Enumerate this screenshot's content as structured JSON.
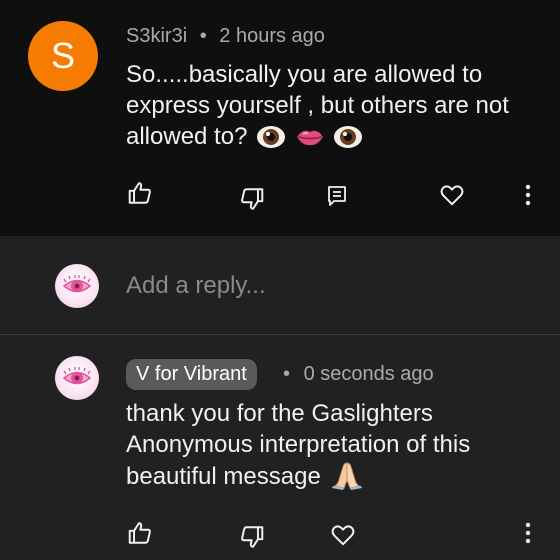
{
  "comment": {
    "avatar_letter": "S",
    "avatar_color": "#f57c00",
    "author": "S3kir3i",
    "separator": "•",
    "time": "2 hours ago",
    "text": "So.....basically you are allowed to express yourself , but others are not allowed to?",
    "emojis": [
      "eye-emoji",
      "lips-emoji",
      "eye-emoji"
    ],
    "actions": [
      "like-icon",
      "dislike-icon",
      "reply-icon",
      "heart-icon",
      "more-icon"
    ]
  },
  "reply_box": {
    "placeholder": "Add a reply..."
  },
  "reply": {
    "author": "V for Vibrant",
    "separator": "•",
    "time": "0 seconds ago",
    "text": "thank you for the Gaslighters Anonymous interpretation of this beautiful message",
    "emoji": "folded-hands-emoji",
    "actions": [
      "like-icon",
      "dislike-icon",
      "heart-icon",
      "more-icon"
    ]
  },
  "colors": {
    "top_background": "#0f0f0f",
    "page_background": "#212121",
    "author_chip": "#5a5a5a",
    "secondary_text": "#aaaaaa"
  }
}
